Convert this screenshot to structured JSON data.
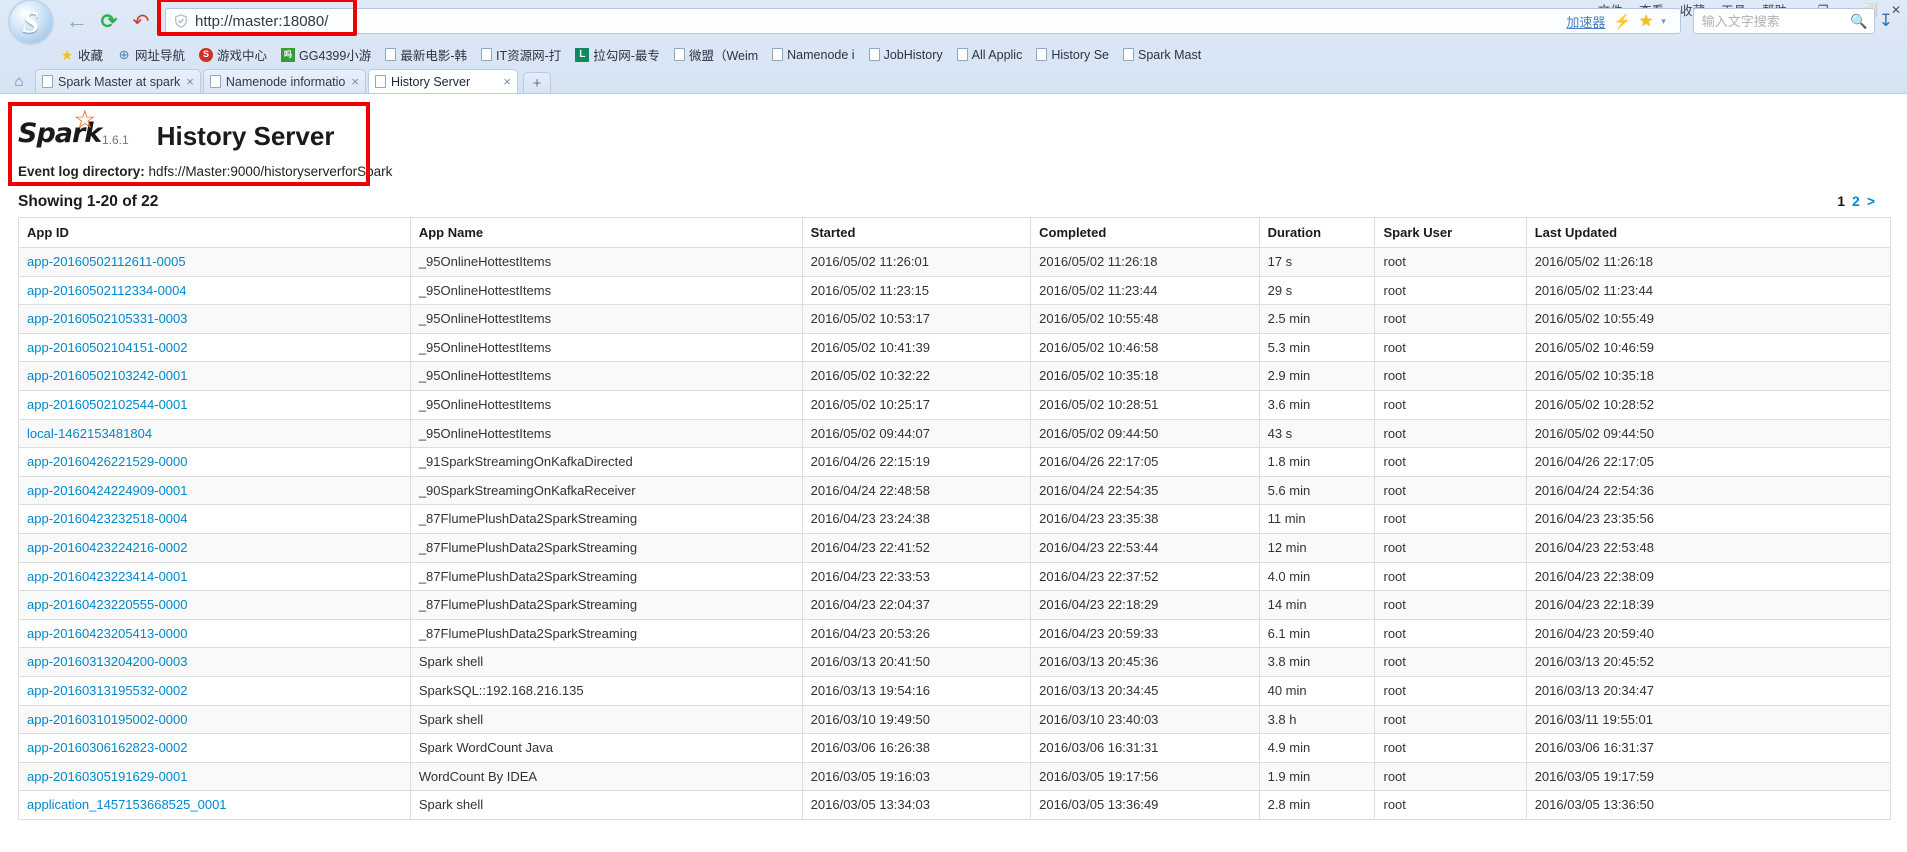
{
  "browser": {
    "url": "http://master:18080/",
    "shield_icon": "shield-check-icon",
    "back_icon": "←",
    "reload_icon": "⟳",
    "home_icon": "↶",
    "accelerator_label": "加速器",
    "bolt_icon": "⚡",
    "star_icon": "★",
    "caret_icon": "▾",
    "search_placeholder": "输入文字搜索",
    "search_value": "",
    "magnifier_icon": "⚲",
    "download_icon": "↧",
    "menu_items": [
      "文件",
      "查看",
      "收藏",
      "工具",
      "帮助"
    ],
    "window_controls": [
      "⬜",
      "─",
      "❐",
      "✕"
    ],
    "bookmarks": [
      {
        "label": "收藏",
        "icon": "star-icon",
        "icon_class": "star",
        "glyph": "★"
      },
      {
        "label": "网址导航",
        "icon": "globe-icon",
        "icon_class": "globe",
        "glyph": "⊕"
      },
      {
        "label": "游戏中心",
        "icon": "game-center-icon",
        "icon_class": "circle-s",
        "glyph": "S"
      },
      {
        "label": "GG4399小游",
        "icon": "gg4399-icon",
        "icon_class": "gg",
        "glyph": "吗"
      },
      {
        "label": "最新电影-韩",
        "icon": "page-icon",
        "icon_class": "page",
        "glyph": ""
      },
      {
        "label": "IT资源网-打",
        "icon": "page-icon",
        "icon_class": "page",
        "glyph": ""
      },
      {
        "label": "拉勾网-最专",
        "icon": "lagou-icon",
        "icon_class": "lagou",
        "glyph": "L"
      },
      {
        "label": "微盟（Weim",
        "icon": "page-icon",
        "icon_class": "page",
        "glyph": ""
      },
      {
        "label": "Namenode i",
        "icon": "page-icon",
        "icon_class": "page",
        "glyph": ""
      },
      {
        "label": "JobHistory",
        "icon": "page-icon",
        "icon_class": "page",
        "glyph": ""
      },
      {
        "label": "All Applic",
        "icon": "page-icon",
        "icon_class": "page",
        "glyph": ""
      },
      {
        "label": "History Se",
        "icon": "page-icon",
        "icon_class": "page",
        "glyph": ""
      },
      {
        "label": "Spark Mast",
        "icon": "page-icon",
        "icon_class": "page",
        "glyph": ""
      }
    ],
    "tabs": [
      {
        "title": "Spark Master at spark",
        "active": false,
        "close_icon": "×"
      },
      {
        "title": "Namenode informatio",
        "active": false,
        "close_icon": "×"
      },
      {
        "title": "History Server",
        "active": true,
        "close_icon": "×"
      }
    ],
    "new_tab_icon": "+",
    "home_tab_icon": "⌂"
  },
  "app": {
    "logo_word": "Spark",
    "logo_star": "☆",
    "version": "1.6.1",
    "title": "History Server",
    "event_log_label": "Event log directory:",
    "event_log_path": "hdfs://Master:9000/historyserverforSpark",
    "showing": "Showing 1-20 of 22",
    "pagination": {
      "current": "1",
      "next_page": "2",
      "next_arrow": ">"
    },
    "link_color": "#0088cc"
  },
  "table": {
    "columns": [
      "App ID",
      "App Name",
      "Started",
      "Completed",
      "Duration",
      "Spark User",
      "Last Updated"
    ],
    "rows": [
      {
        "app_id": "app-20160502112611-0005",
        "app_name": "_95OnlineHottestItems",
        "started": "2016/05/02 11:26:01",
        "completed": "2016/05/02 11:26:18",
        "duration": "17 s",
        "user": "root",
        "updated": "2016/05/02 11:26:18"
      },
      {
        "app_id": "app-20160502112334-0004",
        "app_name": "_95OnlineHottestItems",
        "started": "2016/05/02 11:23:15",
        "completed": "2016/05/02 11:23:44",
        "duration": "29 s",
        "user": "root",
        "updated": "2016/05/02 11:23:44"
      },
      {
        "app_id": "app-20160502105331-0003",
        "app_name": "_95OnlineHottestItems",
        "started": "2016/05/02 10:53:17",
        "completed": "2016/05/02 10:55:48",
        "duration": "2.5 min",
        "user": "root",
        "updated": "2016/05/02 10:55:49"
      },
      {
        "app_id": "app-20160502104151-0002",
        "app_name": "_95OnlineHottestItems",
        "started": "2016/05/02 10:41:39",
        "completed": "2016/05/02 10:46:58",
        "duration": "5.3 min",
        "user": "root",
        "updated": "2016/05/02 10:46:59"
      },
      {
        "app_id": "app-20160502103242-0001",
        "app_name": "_95OnlineHottestItems",
        "started": "2016/05/02 10:32:22",
        "completed": "2016/05/02 10:35:18",
        "duration": "2.9 min",
        "user": "root",
        "updated": "2016/05/02 10:35:18"
      },
      {
        "app_id": "app-20160502102544-0001",
        "app_name": "_95OnlineHottestItems",
        "started": "2016/05/02 10:25:17",
        "completed": "2016/05/02 10:28:51",
        "duration": "3.6 min",
        "user": "root",
        "updated": "2016/05/02 10:28:52"
      },
      {
        "app_id": "local-1462153481804",
        "app_name": "_95OnlineHottestItems",
        "started": "2016/05/02 09:44:07",
        "completed": "2016/05/02 09:44:50",
        "duration": "43 s",
        "user": "root",
        "updated": "2016/05/02 09:44:50"
      },
      {
        "app_id": "app-20160426221529-0000",
        "app_name": "_91SparkStreamingOnKafkaDirected",
        "started": "2016/04/26 22:15:19",
        "completed": "2016/04/26 22:17:05",
        "duration": "1.8 min",
        "user": "root",
        "updated": "2016/04/26 22:17:05"
      },
      {
        "app_id": "app-20160424224909-0001",
        "app_name": "_90SparkStreamingOnKafkaReceiver",
        "started": "2016/04/24 22:48:58",
        "completed": "2016/04/24 22:54:35",
        "duration": "5.6 min",
        "user": "root",
        "updated": "2016/04/24 22:54:36"
      },
      {
        "app_id": "app-20160423232518-0004",
        "app_name": "_87FlumePlushData2SparkStreaming",
        "started": "2016/04/23 23:24:38",
        "completed": "2016/04/23 23:35:38",
        "duration": "11 min",
        "user": "root",
        "updated": "2016/04/23 23:35:56"
      },
      {
        "app_id": "app-20160423224216-0002",
        "app_name": "_87FlumePlushData2SparkStreaming",
        "started": "2016/04/23 22:41:52",
        "completed": "2016/04/23 22:53:44",
        "duration": "12 min",
        "user": "root",
        "updated": "2016/04/23 22:53:48"
      },
      {
        "app_id": "app-20160423223414-0001",
        "app_name": "_87FlumePlushData2SparkStreaming",
        "started": "2016/04/23 22:33:53",
        "completed": "2016/04/23 22:37:52",
        "duration": "4.0 min",
        "user": "root",
        "updated": "2016/04/23 22:38:09"
      },
      {
        "app_id": "app-20160423220555-0000",
        "app_name": "_87FlumePlushData2SparkStreaming",
        "started": "2016/04/23 22:04:37",
        "completed": "2016/04/23 22:18:29",
        "duration": "14 min",
        "user": "root",
        "updated": "2016/04/23 22:18:39"
      },
      {
        "app_id": "app-20160423205413-0000",
        "app_name": "_87FlumePlushData2SparkStreaming",
        "started": "2016/04/23 20:53:26",
        "completed": "2016/04/23 20:59:33",
        "duration": "6.1 min",
        "user": "root",
        "updated": "2016/04/23 20:59:40"
      },
      {
        "app_id": "app-20160313204200-0003",
        "app_name": "Spark shell",
        "started": "2016/03/13 20:41:50",
        "completed": "2016/03/13 20:45:36",
        "duration": "3.8 min",
        "user": "root",
        "updated": "2016/03/13 20:45:52"
      },
      {
        "app_id": "app-20160313195532-0002",
        "app_name": "SparkSQL::192.168.216.135",
        "started": "2016/03/13 19:54:16",
        "completed": "2016/03/13 20:34:45",
        "duration": "40 min",
        "user": "root",
        "updated": "2016/03/13 20:34:47"
      },
      {
        "app_id": "app-20160310195002-0000",
        "app_name": "Spark shell",
        "started": "2016/03/10 19:49:50",
        "completed": "2016/03/10 23:40:03",
        "duration": "3.8 h",
        "user": "root",
        "updated": "2016/03/11 19:55:01"
      },
      {
        "app_id": "app-20160306162823-0002",
        "app_name": "Spark WordCount Java",
        "started": "2016/03/06 16:26:38",
        "completed": "2016/03/06 16:31:31",
        "duration": "4.9 min",
        "user": "root",
        "updated": "2016/03/06 16:31:37"
      },
      {
        "app_id": "app-20160305191629-0001",
        "app_name": "WordCount By IDEA",
        "started": "2016/03/05 19:16:03",
        "completed": "2016/03/05 19:17:56",
        "duration": "1.9 min",
        "user": "root",
        "updated": "2016/03/05 19:17:59"
      },
      {
        "app_id": "application_1457153668525_0001",
        "app_name": "Spark shell",
        "started": "2016/03/05 13:34:03",
        "completed": "2016/03/05 13:36:49",
        "duration": "2.8 min",
        "user": "root",
        "updated": "2016/03/05 13:36:50"
      }
    ]
  }
}
